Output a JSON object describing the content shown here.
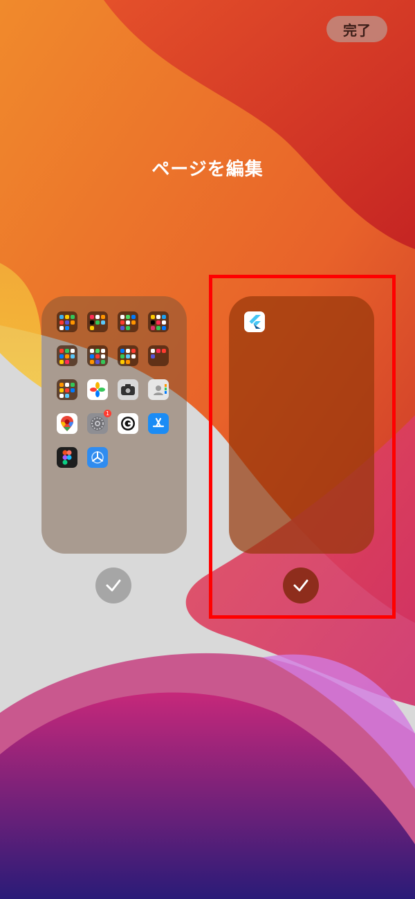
{
  "header": {
    "done_label": "完了"
  },
  "title": "ページを編集",
  "pages": [
    {
      "id": "page-1",
      "selected": true,
      "apps": [
        "folder",
        "folder",
        "folder",
        "folder",
        "folder",
        "folder",
        "folder",
        "folder",
        "folder",
        "photos-icon",
        "camera-icon",
        "contacts-icon",
        "google-maps-icon",
        "settings-icon",
        "gmail-like-icon",
        "app-store-icon",
        "figma-icon",
        "testflight-icon"
      ],
      "settings_badge": "1"
    },
    {
      "id": "page-2",
      "selected": true,
      "apps": [
        "flutter-icon"
      ]
    }
  ],
  "colors": {
    "check_unselected": "#a6a6a6",
    "check_selected": "#8e2d1c",
    "highlight": "#ff0000"
  }
}
